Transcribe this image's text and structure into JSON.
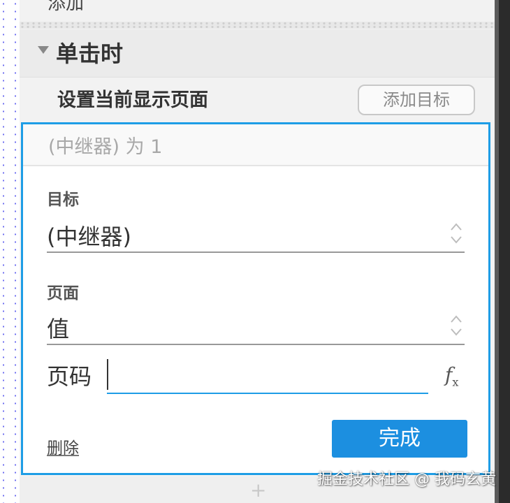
{
  "top_item": {
    "label": "添加"
  },
  "event": {
    "title": "单击时"
  },
  "action": {
    "label": "设置当前显示页面",
    "add_target_label": "添加目标"
  },
  "editor": {
    "summary": "(中继器) 为 1",
    "target": {
      "label": "目标",
      "value": "(中继器)"
    },
    "page": {
      "label": "页面",
      "value": "值"
    },
    "page_number": {
      "label": "页码",
      "value": "",
      "fx_label": "f",
      "fx_sub": "x"
    },
    "delete_label": "删除",
    "done_label": "完成"
  },
  "below": {
    "add_symbol": "+"
  },
  "watermark": "掘金技术社区 @ 我码玄黄",
  "colors": {
    "accent": "#1e9de6",
    "done_button": "#1c8fe0",
    "panel_bg": "#f2f2f2"
  },
  "icons": {
    "collapse": "triangle-down-icon",
    "select_arrows": "chevron-updown-icon",
    "function": "fx-icon",
    "add": "plus-icon"
  }
}
